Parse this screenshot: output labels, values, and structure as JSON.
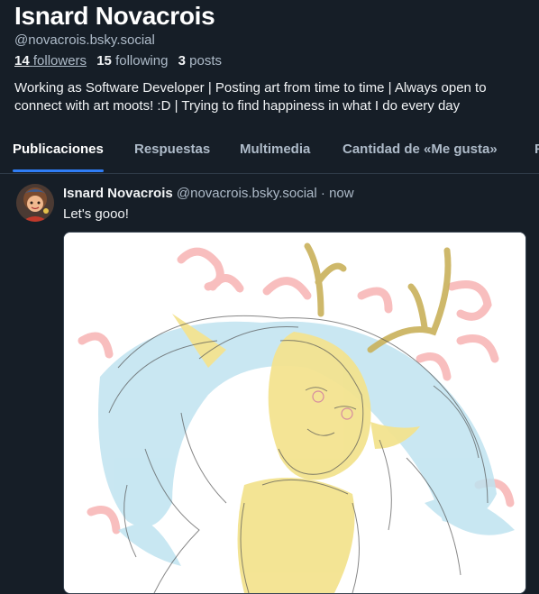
{
  "profile": {
    "display_name": "Isnard Novacrois",
    "handle": "@novacrois.bsky.social",
    "followers_count": "14",
    "followers_label": "followers",
    "following_count": "15",
    "following_label": "following",
    "posts_count": "3",
    "posts_label": "posts",
    "bio_line1": "Working as Software Developer | Posting art from time to time | Always open to",
    "bio_line2": "connect with art moots! :D | Trying to find happiness in what I do every day"
  },
  "tabs": [
    {
      "label": "Publicaciones",
      "active": true
    },
    {
      "label": "Respuestas",
      "active": false
    },
    {
      "label": "Multimedia",
      "active": false
    },
    {
      "label": "Cantidad de «Me gusta»",
      "active": false
    }
  ],
  "post": {
    "author": "Isnard Novacrois",
    "handle": "@novacrois.bsky.social",
    "separator": "·",
    "time": "now",
    "text": "Let's goo​o!",
    "image_icon": "sketch-artwork-image"
  },
  "colors": {
    "background": "#161e27",
    "accent": "#2f7df6",
    "muted": "#aebbc9"
  }
}
